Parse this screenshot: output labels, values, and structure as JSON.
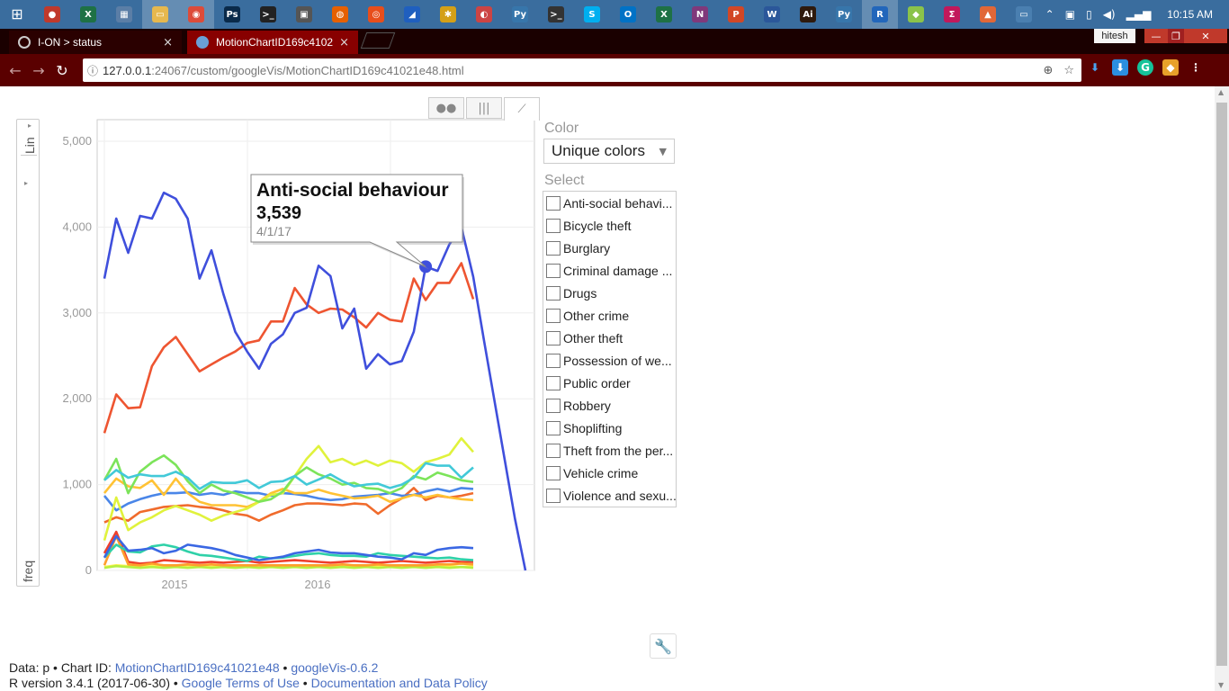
{
  "taskbar": {
    "icons": [
      {
        "name": "app-icon-1",
        "color": "#c0392b",
        "glyph": "●"
      },
      {
        "name": "excel-icon",
        "color": "#1e7145",
        "glyph": "X"
      },
      {
        "name": "calculator-icon",
        "color": "#5b7ea6",
        "glyph": "▦"
      },
      {
        "name": "file-explorer-icon",
        "color": "#e6b84e",
        "glyph": "▭"
      },
      {
        "name": "chrome-icon",
        "color": "#dd4b39",
        "glyph": "◉"
      },
      {
        "name": "photoshop-icon",
        "color": "#0a2a4a",
        "glyph": "Ps"
      },
      {
        "name": "cmd-icon",
        "color": "#222222",
        "glyph": ">_"
      },
      {
        "name": "app-icon-8",
        "color": "#555555",
        "glyph": "▣"
      },
      {
        "name": "firefox-icon",
        "color": "#e66000",
        "glyph": "◍"
      },
      {
        "name": "app-icon-10",
        "color": "#e84e1b",
        "glyph": "◎"
      },
      {
        "name": "app-icon-11",
        "color": "#1f5fbf",
        "glyph": "◢"
      },
      {
        "name": "app-icon-12",
        "color": "#d4a017",
        "glyph": "✱"
      },
      {
        "name": "app-icon-13",
        "color": "#c44",
        "glyph": "◐"
      },
      {
        "name": "python-icon",
        "color": "#3776ab",
        "glyph": "Py"
      },
      {
        "name": "terminal-icon",
        "color": "#333333",
        "glyph": ">_"
      },
      {
        "name": "skype-icon",
        "color": "#00aff0",
        "glyph": "S"
      },
      {
        "name": "outlook-icon",
        "color": "#0072c6",
        "glyph": "O"
      },
      {
        "name": "excel-icon-2",
        "color": "#1e7145",
        "glyph": "X"
      },
      {
        "name": "onenote-icon",
        "color": "#80397b",
        "glyph": "N"
      },
      {
        "name": "powerpoint-icon",
        "color": "#d24726",
        "glyph": "P"
      },
      {
        "name": "word-icon",
        "color": "#2b579a",
        "glyph": "W"
      },
      {
        "name": "illustrator-icon",
        "color": "#2e1a0d",
        "glyph": "Ai"
      },
      {
        "name": "python-icon-2",
        "color": "#3776ab",
        "glyph": "Py"
      },
      {
        "name": "r-icon",
        "color": "#2266bb",
        "glyph": "R"
      },
      {
        "name": "app-icon-25",
        "color": "#8bc34a",
        "glyph": "◆"
      },
      {
        "name": "app-icon-26",
        "color": "#c2185b",
        "glyph": "Σ"
      },
      {
        "name": "matlab-icon",
        "color": "#e16737",
        "glyph": "▲"
      },
      {
        "name": "app-icon-28",
        "color": "#4a7fb0",
        "glyph": "▭"
      }
    ],
    "clock": "10:15 AM"
  },
  "browser": {
    "tabs": [
      {
        "title": "I-ON > status",
        "close": "×"
      },
      {
        "title": "MotionChartID169c4102",
        "close": "×"
      }
    ],
    "user": "hitesh",
    "url_host": "127.0.0.1",
    "url_rest": ":24067/custom/googleVis/MotionChartID169c41021e48.html"
  },
  "chart": {
    "y_scale_label": "Lin",
    "y_axis_label": "freq",
    "chart_data": {
      "type": "line",
      "ylim": [
        0,
        5000
      ],
      "yticks": [
        "5,000",
        "4,000",
        "3,000",
        "2,000",
        "1,000",
        "0"
      ],
      "xticks": [
        "2015",
        "2016"
      ],
      "x": [
        "6/1/14",
        "7/1/14",
        "8/1/14",
        "9/1/14",
        "10/1/14",
        "11/1/14",
        "12/1/14",
        "1/1/15",
        "2/1/15",
        "3/1/15",
        "4/1/15",
        "5/1/15",
        "6/1/15",
        "7/1/15",
        "8/1/15",
        "9/1/15",
        "10/1/15",
        "11/1/15",
        "12/1/15",
        "1/1/16",
        "2/1/16",
        "3/1/16",
        "4/1/16",
        "5/1/16",
        "6/1/16",
        "7/1/16",
        "8/1/16",
        "9/1/16",
        "10/1/16",
        "11/1/16",
        "12/1/16",
        "1/1/17",
        "2/1/17",
        "3/1/17",
        "4/1/17",
        "5/1/17",
        "6/1/17",
        "7/1/17",
        "8/1/17",
        "9/1/17",
        "10/1/17",
        "11/1/17",
        "12/1/17",
        "1/1/18",
        "2/1/18",
        "3/1/18"
      ],
      "series": [
        {
          "color": "#3f4fdc",
          "values": [
            3400,
            4100,
            3700,
            4130,
            4100,
            4400,
            4330,
            4100,
            3400,
            3730,
            3220,
            2780,
            2550,
            2350,
            2640,
            2750,
            3000,
            3060,
            3550,
            3430,
            2820,
            3050,
            2350,
            2520,
            2400,
            2440,
            2780,
            3540,
            3490,
            3800,
            4000,
            3420,
            2700,
            2000,
            1300,
            600,
            0
          ]
        },
        {
          "color": "#ee5531",
          "values": [
            1600,
            2050,
            1890,
            1900,
            2380,
            2600,
            2720,
            2520,
            2320,
            2400,
            2480,
            2550,
            2650,
            2680,
            2900,
            2900,
            3290,
            3100,
            3000,
            3050,
            3040,
            2950,
            2830,
            3000,
            2920,
            2900,
            3400,
            3150,
            3350,
            3350,
            3580,
            3160
          ]
        },
        {
          "color": "#42c9d8",
          "values": [
            1050,
            1170,
            1080,
            1120,
            1100,
            1100,
            1150,
            1080,
            950,
            1030,
            1020,
            1020,
            1050,
            960,
            1030,
            1040,
            1100,
            1000,
            1060,
            1120,
            1040,
            980,
            1000,
            1010,
            960,
            1000,
            1080,
            1250,
            1220,
            1220,
            1080,
            1200
          ]
        },
        {
          "color": "#7ce45a",
          "values": [
            1050,
            1300,
            900,
            1150,
            1260,
            1340,
            1230,
            1040,
            900,
            1000,
            930,
            900,
            850,
            800,
            830,
            920,
            1100,
            1200,
            1120,
            1070,
            1000,
            1020,
            960,
            950,
            900,
            960,
            1100,
            1060,
            1140,
            1100,
            1050,
            1030
          ]
        },
        {
          "color": "#e0f23c",
          "values": [
            350,
            850,
            470,
            560,
            620,
            700,
            750,
            700,
            650,
            580,
            640,
            680,
            720,
            800,
            880,
            900,
            1100,
            1300,
            1450,
            1260,
            1300,
            1230,
            1280,
            1220,
            1280,
            1250,
            1150,
            1260,
            1300,
            1350,
            1540,
            1380
          ]
        },
        {
          "color": "#ffc234",
          "values": [
            900,
            1070,
            980,
            960,
            1050,
            880,
            1070,
            900,
            800,
            760,
            760,
            760,
            740,
            800,
            900,
            950,
            900,
            900,
            940,
            900,
            870,
            840,
            850,
            870,
            800,
            840,
            880,
            850,
            880,
            850,
            830,
            820
          ]
        },
        {
          "color": "#4a86e8",
          "values": [
            870,
            700,
            780,
            830,
            870,
            900,
            900,
            910,
            880,
            900,
            880,
            920,
            900,
            900,
            870,
            900,
            890,
            870,
            840,
            820,
            830,
            860,
            870,
            880,
            900,
            870,
            880,
            920,
            950,
            920,
            960,
            950
          ]
        },
        {
          "color": "#f06b2c",
          "values": [
            560,
            620,
            580,
            680,
            710,
            740,
            750,
            760,
            740,
            730,
            700,
            660,
            640,
            580,
            650,
            700,
            760,
            780,
            780,
            770,
            760,
            780,
            770,
            660,
            760,
            840,
            960,
            820,
            870,
            850,
            870,
            900
          ]
        },
        {
          "color": "#3a67e3",
          "values": [
            150,
            400,
            230,
            240,
            260,
            200,
            230,
            300,
            280,
            260,
            230,
            180,
            150,
            120,
            140,
            160,
            200,
            220,
            240,
            210,
            200,
            200,
            180,
            160,
            150,
            130,
            200,
            180,
            240,
            260,
            270,
            260
          ]
        },
        {
          "color": "#2fd1a8",
          "values": [
            150,
            300,
            220,
            210,
            280,
            300,
            270,
            220,
            180,
            170,
            150,
            130,
            110,
            160,
            140,
            150,
            170,
            190,
            200,
            180,
            170,
            170,
            160,
            200,
            180,
            170,
            160,
            150,
            140,
            150,
            130,
            120
          ]
        },
        {
          "color": "#ff9e2c",
          "values": [
            60,
            400,
            70,
            60,
            80,
            60,
            60,
            70,
            60,
            70,
            60,
            60,
            60,
            60,
            60,
            60,
            60,
            60,
            60,
            60,
            70,
            60,
            60,
            70,
            60,
            60,
            60,
            60,
            70,
            70,
            80,
            70
          ]
        },
        {
          "color": "#ee3f2c",
          "values": [
            200,
            450,
            100,
            80,
            90,
            120,
            110,
            100,
            90,
            100,
            90,
            100,
            110,
            90,
            100,
            110,
            120,
            110,
            100,
            90,
            100,
            110,
            100,
            90,
            100,
            110,
            100,
            90,
            100,
            110,
            100,
            100
          ]
        },
        {
          "color": "#b6ef42",
          "values": [
            30,
            50,
            40,
            30,
            40,
            30,
            40,
            30,
            40,
            30,
            40,
            30,
            40,
            30,
            40,
            30,
            40,
            30,
            40,
            30,
            40,
            30,
            40,
            30,
            40,
            30,
            40,
            30,
            40,
            30,
            40,
            30
          ]
        },
        {
          "color": "#fff24a",
          "values": [
            40,
            60,
            50,
            40,
            60,
            50,
            40,
            60,
            50,
            40,
            60,
            50,
            40,
            60,
            50,
            40,
            60,
            50,
            40,
            60,
            50,
            40,
            60,
            50,
            40,
            60,
            50,
            40,
            60,
            50,
            40,
            50
          ]
        }
      ],
      "tooltip": {
        "series_name": "Anti-social behaviour",
        "value": "3,539",
        "date": "4/1/17",
        "point_index": 27,
        "point_value": 3539
      }
    },
    "view_tabs": [
      "bubble-view",
      "bar-view",
      "line-view"
    ]
  },
  "panel": {
    "color_label": "Color",
    "color_value": "Unique colors",
    "select_label": "Select",
    "items": [
      "Anti-social behavi...",
      "Bicycle theft",
      "Burglary",
      "Criminal damage ...",
      "Drugs",
      "Other crime",
      "Other theft",
      "Possession of we...",
      "Public order",
      "Robbery",
      "Shoplifting",
      "Theft from the per...",
      "Vehicle crime",
      "Violence and sexu..."
    ]
  },
  "footer": {
    "line1_prefix": "Data: p • Chart ID: ",
    "chart_id": "MotionChartID169c41021e48",
    "sep1": " • ",
    "googlevis": "googleVis-0.6.2",
    "line2_prefix": "R version 3.4.1 (2017-06-30) • ",
    "terms": "Google Terms of Use",
    "sep2": " • ",
    "docs": "Documentation and Data Policy"
  }
}
